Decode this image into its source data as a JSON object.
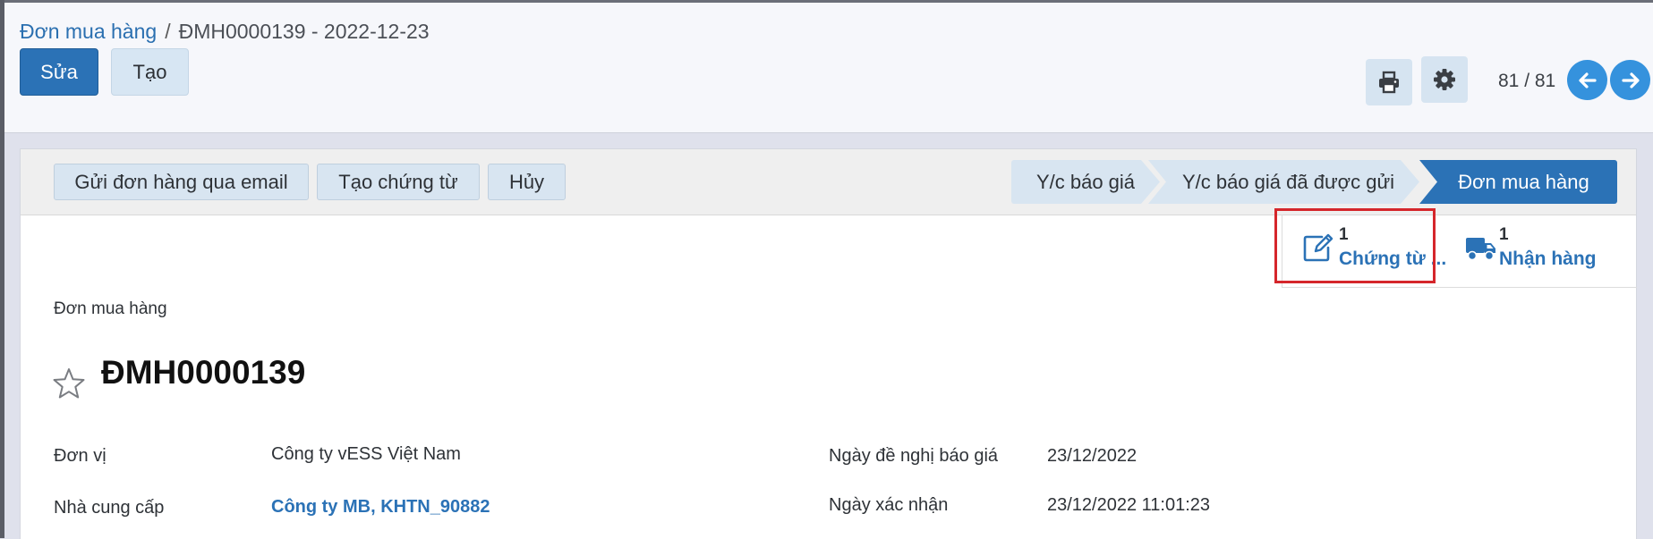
{
  "breadcrumb": {
    "parent": "Đơn mua hàng",
    "separator": "/",
    "current": "ĐMH0000139 - 2022-12-23"
  },
  "toolbar": {
    "edit_label": "Sửa",
    "create_label": "Tạo",
    "print_icon": "print-icon",
    "settings_icon": "gear-icon",
    "pager": "81 / 81",
    "prev_icon": "arrow-left-icon",
    "next_icon": "arrow-right-icon"
  },
  "status_actions": [
    "Gửi đơn hàng qua email",
    "Tạo chứng từ",
    "Hủy"
  ],
  "stages": [
    {
      "label": "Y/c báo giá",
      "active": false
    },
    {
      "label": "Y/c báo giá đã được gửi",
      "active": false
    },
    {
      "label": "Đơn mua hàng",
      "active": true
    }
  ],
  "smart_buttons": [
    {
      "count": "1",
      "label": "Chứng từ ...",
      "icon": "edit-icon",
      "highlighted": true
    },
    {
      "count": "1",
      "label": "Nhận hàng",
      "icon": "truck-icon",
      "highlighted": false
    }
  ],
  "form": {
    "doc_type": "Đơn mua hàng",
    "doc_name": "ĐMH0000139",
    "favorite": false,
    "fields_left": [
      {
        "label": "Đơn vị",
        "value": "Công ty vESS Việt Nam",
        "link": false
      },
      {
        "label": "Nhà cung cấp",
        "value": "Công ty MB, KHTN_90882",
        "link": true
      }
    ],
    "fields_right": [
      {
        "label": "Ngày đề nghị báo giá",
        "value": "23/12/2022"
      },
      {
        "label": "Ngày xác nhận",
        "value": "23/12/2022 11:01:23"
      }
    ]
  },
  "colors": {
    "primary": "#2b72b6",
    "highlight_border": "#d5262b",
    "background": "#dfe1ec"
  }
}
